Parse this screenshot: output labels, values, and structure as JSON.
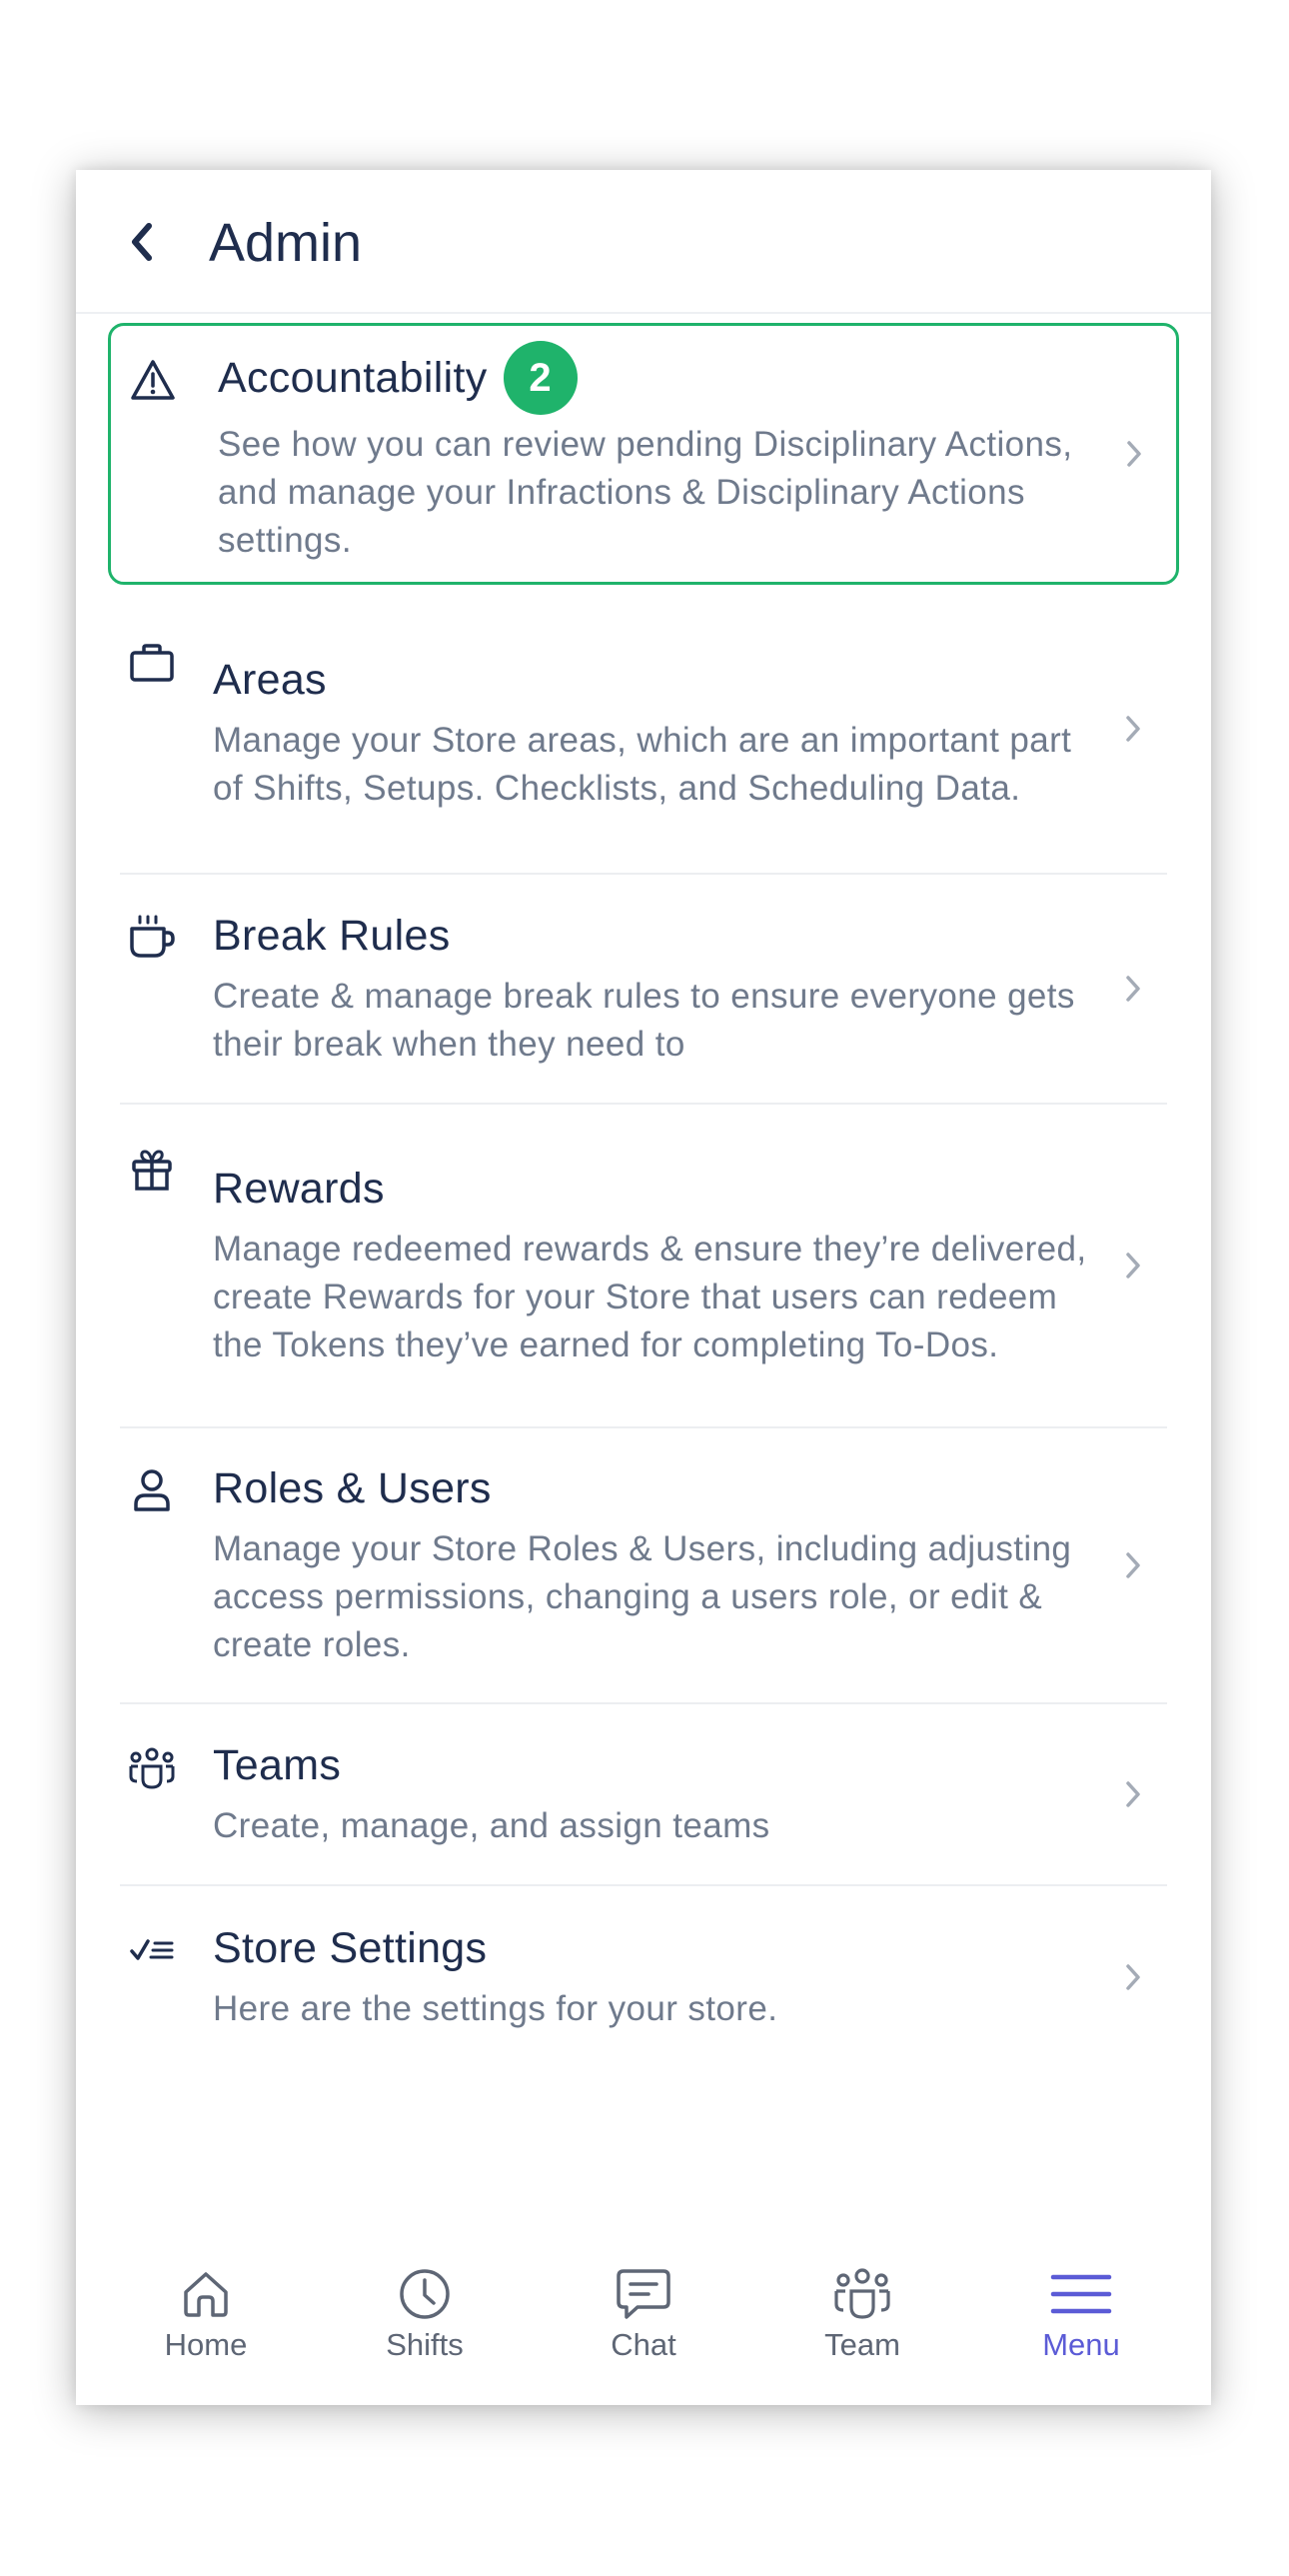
{
  "header": {
    "title": "Admin"
  },
  "items": [
    {
      "title": "Accountability",
      "badge": "2",
      "description": "See how you can review pending Disciplinary Actions, and manage your Infractions & Disciplinary Actions settings.",
      "icon": "warning-triangle-icon"
    },
    {
      "title": "Areas",
      "description": "Manage your Store areas, which are an important part of Shifts, Setups. Checklists, and Scheduling Data.",
      "icon": "briefcase-icon"
    },
    {
      "title": "Break Rules",
      "description": "Create & manage break rules to ensure everyone gets their break when they need to",
      "icon": "coffee-cup-icon"
    },
    {
      "title": "Rewards",
      "description": "Manage redeemed rewards & ensure they’re delivered, create Rewards for your Store that users can redeem the Tokens they’ve earned for completing To-Dos.",
      "icon": "gift-icon"
    },
    {
      "title": "Roles & Users",
      "description": "Manage your Store Roles & Users, including adjusting access permissions, changing a users role, or edit & create roles.",
      "icon": "user-icon"
    },
    {
      "title": "Teams",
      "description": "Create, manage, and assign teams",
      "icon": "team-icon"
    },
    {
      "title": "Store Settings",
      "description": "Here are the settings for your store.",
      "icon": "checklist-icon"
    }
  ],
  "tabbar": {
    "tabs": [
      {
        "label": "Home",
        "icon": "home-icon",
        "active": false
      },
      {
        "label": "Shifts",
        "icon": "clock-icon",
        "active": false
      },
      {
        "label": "Chat",
        "icon": "chat-icon",
        "active": false
      },
      {
        "label": "Team",
        "icon": "team-icon",
        "active": false
      },
      {
        "label": "Menu",
        "icon": "menu-icon",
        "active": true
      }
    ]
  },
  "colors": {
    "accent": "#5b5bd6",
    "highlight_border": "#1fb36b",
    "badge": "#1fb36b",
    "title_text": "#1f2d4d",
    "description_text": "#6f7a8c"
  }
}
